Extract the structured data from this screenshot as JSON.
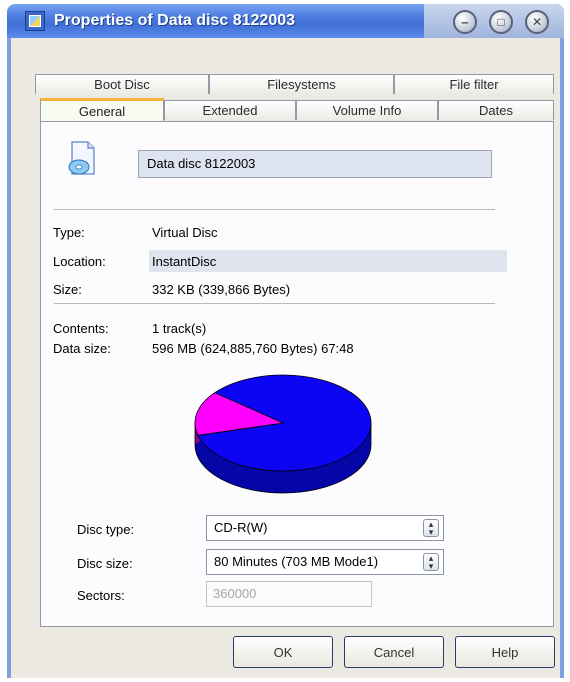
{
  "window": {
    "title": "Properties of Data disc 8122003",
    "controls": {
      "minimize": "‒",
      "maximize": "□",
      "close": "✕"
    }
  },
  "tabs": {
    "row1": [
      "Boot Disc",
      "Filesystems",
      "File filter"
    ],
    "row2": [
      "General",
      "Extended",
      "Volume Info",
      "Dates"
    ],
    "active": "General"
  },
  "general": {
    "disc_name": "Data disc 8122003",
    "info": [
      {
        "label": "Type:",
        "value": "Virtual Disc"
      },
      {
        "label": "Location:",
        "value": "InstantDisc"
      },
      {
        "label": "Size:",
        "value": "332 KB (339,866 Bytes)"
      }
    ],
    "contents_label": "Contents:",
    "contents_value": "1 track(s)",
    "data_size_label": "Data size:",
    "data_size_value": "596 MB (624,885,760 Bytes) 67:48",
    "usage_pie": {
      "used_fraction": 0.85,
      "used_color": "#0b05f3",
      "free_color": "#ff00ff"
    },
    "disc_type_label": "Disc type:",
    "disc_type_value": "CD-R(W)",
    "disc_size_label": "Disc size:",
    "disc_size_value": "80 Minutes (703 MB Mode1)",
    "sectors_label": "Sectors:",
    "sectors_value": "360000"
  },
  "buttons": {
    "ok": "OK",
    "cancel": "Cancel",
    "help": "Help"
  }
}
